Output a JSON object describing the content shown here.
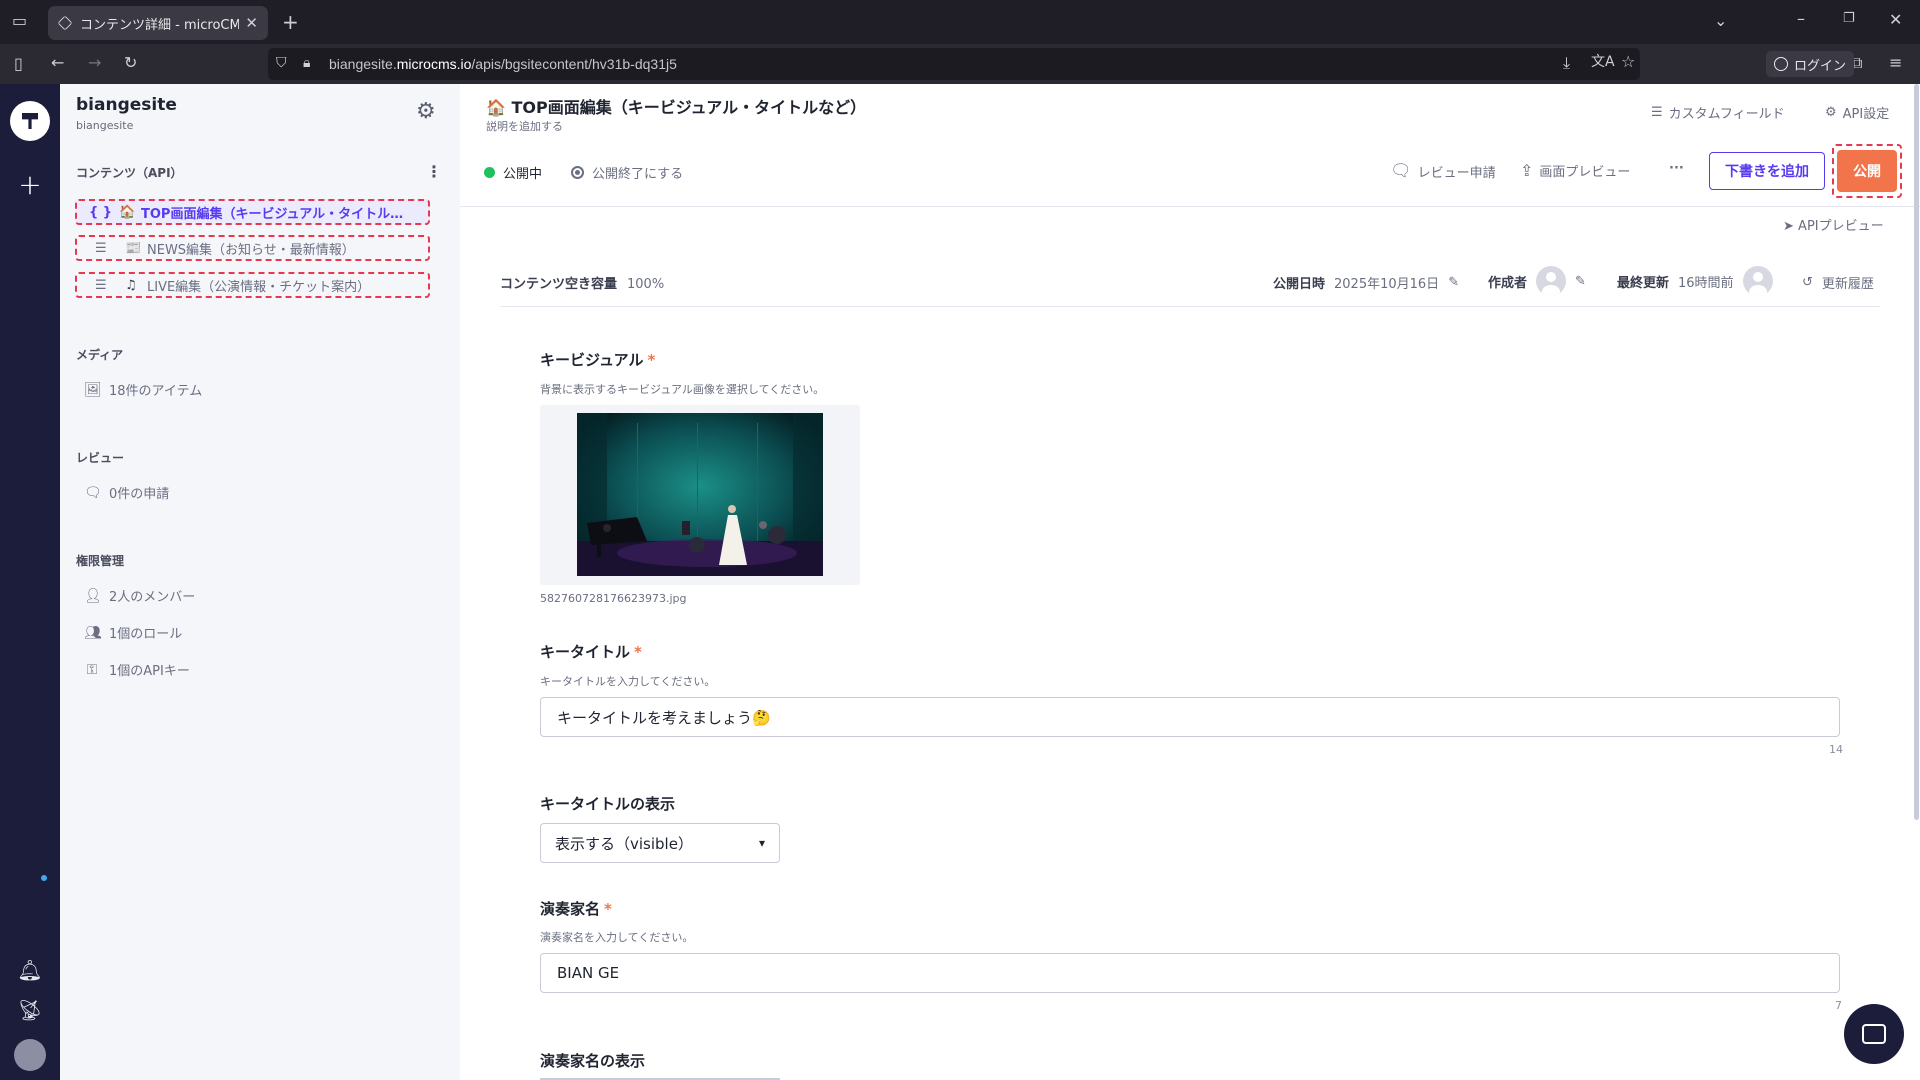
{
  "browser": {
    "tab_title": "コンテンツ詳細 - microCMS",
    "url_prefix": "biangesite.",
    "url_domain": "microcms.io",
    "url_path": "/apis/bgsitecontent/hv31b-dq31j5",
    "login_label": "ログイン"
  },
  "project": {
    "name": "biangesite",
    "sub": "biangesite"
  },
  "sidebar": {
    "contents_title": "コンテンツ（API）",
    "api_items": [
      {
        "icon": "{ }",
        "emoji": "🏠",
        "label": "TOP画面編集（キービジュアル・タイトル…"
      },
      {
        "icon": "☰",
        "emoji": "📰",
        "label": "NEWS編集（お知らせ・最新情報）"
      },
      {
        "icon": "☰",
        "emoji": "♫",
        "label": "LIVE編集（公演情報・チケット案内）"
      }
    ],
    "media_title": "メディア",
    "media_count": "18件のアイテム",
    "review_title": "レビュー",
    "review_count": "0件の申請",
    "perm_title": "権限管理",
    "members": "2人のメンバー",
    "roles": "1個のロール",
    "apikeys": "1個のAPIキー"
  },
  "header": {
    "title": "TOP画面編集（キービジュアル・タイトルなど）",
    "title_emoji": "🏠",
    "sub": "説明を追加する",
    "custom_field": "カスタムフィールド",
    "api_settings": "API設定",
    "status": "公開中",
    "unpublish": "公開終了にする",
    "review_request": "レビュー申請",
    "screen_preview": "画面プレビュー",
    "more": "···",
    "add_draft": "下書きを追加",
    "publish": "公開",
    "api_preview": "APIプレビュー"
  },
  "meta": {
    "capacity_label": "コンテンツ空き容量",
    "capacity_value": "100%",
    "published_label": "公開日時",
    "published_value": "2025年10月16日",
    "author_label": "作成者",
    "updated_label": "最終更新",
    "updated_value": "16時間前",
    "history": "更新履歴"
  },
  "form": {
    "kv_label": "キービジュアル",
    "kv_help": "背景に表示するキービジュアル画像を選択してください。",
    "kv_filename": "582760728176623973.jpg",
    "keytitle_label": "キータイトル",
    "keytitle_help": "キータイトルを入力してください。",
    "keytitle_value": "キータイトルを考えましょう🤔",
    "keytitle_count": "14",
    "keytitle_display_label": "キータイトルの表示",
    "keytitle_display_value": "表示する（visible）",
    "artist_label": "演奏家名",
    "artist_help": "演奏家名を入力してください。",
    "artist_value": "BIAN GE",
    "artist_count": "7",
    "artist_display_label": "演奏家名の表示",
    "required_mark": "*"
  },
  "colors": {
    "accent": "#563bf0",
    "publish": "#f2744a",
    "status_green": "#20c05c",
    "rail": "#1b1d3a",
    "highlight_dashed": "#e8384f"
  }
}
